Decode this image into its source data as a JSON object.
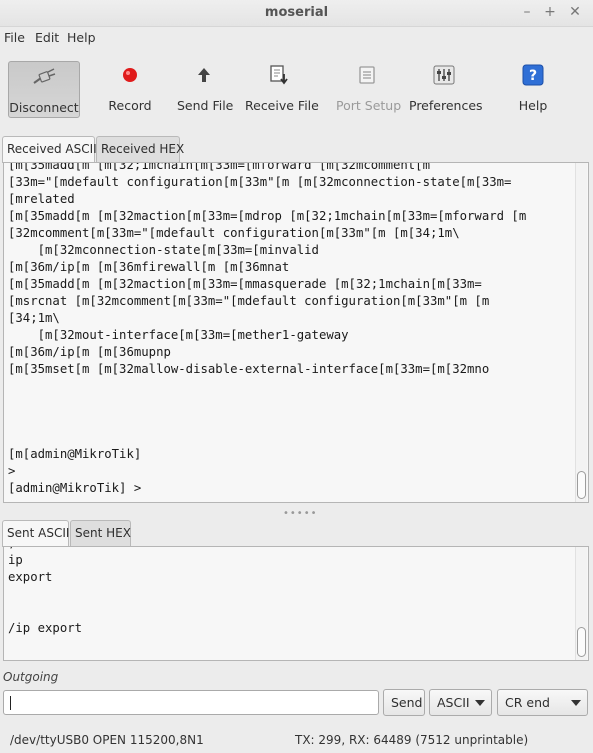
{
  "window": {
    "title": "moserial"
  },
  "menu": {
    "file": "File",
    "edit": "Edit",
    "help": "Help"
  },
  "toolbar": {
    "disconnect": "Disconnect",
    "record": "Record",
    "send_file": "Send File",
    "receive_file": "Receive File",
    "port_setup": "Port Setup",
    "preferences": "Preferences",
    "help": "Help"
  },
  "received_tabs": {
    "ascii": "Received ASCII",
    "hex": "Received HEX"
  },
  "received_lines": [
    "[m[35madd[m [m[32;1mchain[m[33m=[mforward [m[32mcomment[m",
    "[33m=\"[mdefault configuration[m[33m\"[m [m[32mconnection-state[m[33m=",
    "[mrelated",
    "[m[35madd[m [m[32maction[m[33m=[mdrop [m[32;1mchain[m[33m=[mforward [m",
    "[32mcomment[m[33m=\"[mdefault configuration[m[33m\"[m [m[34;1m\\",
    "    [m[32mconnection-state[m[33m=[minvalid",
    "[m[36m/ip[m [m[36mfirewall[m [m[36mnat",
    "[m[35madd[m [m[32maction[m[33m=[mmasquerade [m[32;1mchain[m[33m=",
    "[msrcnat [m[32mcomment[m[33m=\"[mdefault configuration[m[33m\"[m [m",
    "[34;1m\\",
    "    [m[32mout-interface[m[33m=[mether1-gateway",
    "[m[36m/ip[m [m[36mupnp",
    "[m[35mset[m [m[32mallow-disable-external-interface[m[33m=[m[32mno",
    "",
    "",
    "",
    "",
    "[m[admin@MikroTik]",
    ">",
    "[admin@MikroTik] >"
  ],
  "sent_tabs": {
    "ascii": "Sent ASCII",
    "hex": "Sent HEX"
  },
  "sent_lines": [
    ",",
    "ip",
    "export",
    "",
    "",
    "/ip export"
  ],
  "outgoing": {
    "label": "Outgoing",
    "input_value": "",
    "send": "Send",
    "mode": "ASCII",
    "line_end": "CR end"
  },
  "status": {
    "port": "/dev/ttyUSB0 OPEN 115200,8N1",
    "counts": "TX: 299, RX: 64489 (7512 unprintable)"
  },
  "colors": {
    "record_red": "#e01b1b",
    "help_blue": "#2f6fd6"
  }
}
